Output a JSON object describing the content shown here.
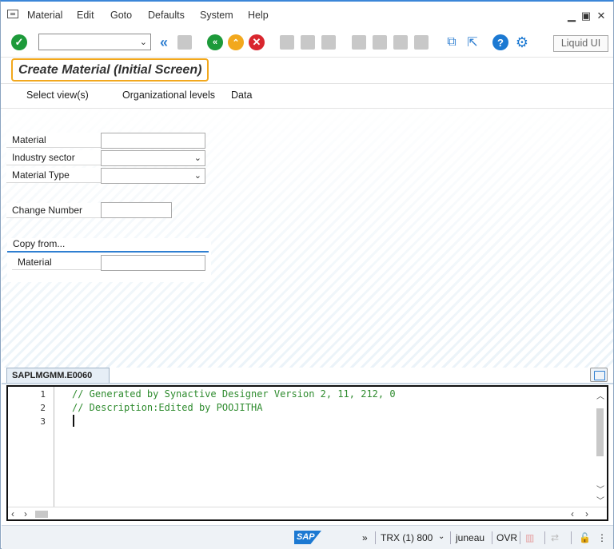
{
  "menu": {
    "items": [
      {
        "label": "Material"
      },
      {
        "label": "Edit"
      },
      {
        "label": "Goto"
      },
      {
        "label": "Defaults"
      },
      {
        "label": "System"
      },
      {
        "label": "Help"
      }
    ]
  },
  "toolbar": {
    "command_field_value": "",
    "liquid_ui_label": "Liquid UI"
  },
  "screen": {
    "title": "Create Material (Initial Screen)"
  },
  "appbar": {
    "select_views": "Select view(s)",
    "org_levels": "Organizational levels",
    "data": "Data"
  },
  "form": {
    "material_label": "Material",
    "material_value": "",
    "industry_sector_label": "Industry sector",
    "industry_sector_value": "",
    "material_type_label": "Material Type",
    "material_type_value": "",
    "change_number_label": "Change Number",
    "change_number_value": "",
    "copy_from": {
      "title": "Copy from...",
      "material_label": "Material",
      "material_value": ""
    }
  },
  "editor": {
    "tab_label": "SAPLMGMM.E0060",
    "lines": [
      {
        "num": "1",
        "text": "// Generated by Synactive Designer Version 2, 11, 212, 0"
      },
      {
        "num": "2",
        "text": "// Description:Edited by POOJITHA"
      },
      {
        "num": "3",
        "text": ""
      }
    ]
  },
  "status": {
    "logo": "SAP",
    "session": "TRX (1) 800",
    "server": "juneau",
    "mode": "OVR"
  }
}
